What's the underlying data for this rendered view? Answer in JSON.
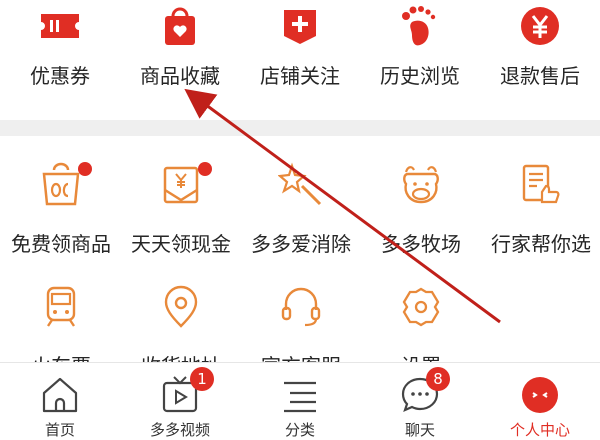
{
  "top_row": [
    {
      "label": "优惠券",
      "icon": "ticket-icon"
    },
    {
      "label": "商品收藏",
      "icon": "shopping-bag-heart-icon"
    },
    {
      "label": "店铺关注",
      "icon": "store-plus-icon"
    },
    {
      "label": "历史浏览",
      "icon": "footprint-icon"
    },
    {
      "label": "退款售后",
      "icon": "yen-coin-icon"
    }
  ],
  "grid_items": [
    {
      "label": "免费领商品",
      "icon": "free-box-icon",
      "has_dot": true
    },
    {
      "label": "天天领现金",
      "icon": "cash-envelope-icon",
      "has_dot": true
    },
    {
      "label": "多多爱消除",
      "icon": "star-wand-icon",
      "has_dot": false
    },
    {
      "label": "多多牧场",
      "icon": "cow-icon",
      "has_dot": false
    },
    {
      "label": "行家帮你选",
      "icon": "thumbs-up-doc-icon",
      "has_dot": false
    },
    {
      "label": "火车票",
      "icon": "train-icon",
      "has_dot": false
    },
    {
      "label": "收货地址",
      "icon": "location-pin-icon",
      "has_dot": false
    },
    {
      "label": "官方客服",
      "icon": "headset-icon",
      "has_dot": false
    },
    {
      "label": "设置",
      "icon": "gear-icon",
      "has_dot": false
    }
  ],
  "tabbar": [
    {
      "label": "首页",
      "icon": "home-icon",
      "badge": "",
      "active": false
    },
    {
      "label": "多多视频",
      "icon": "video-play-icon",
      "badge": "1",
      "active": false
    },
    {
      "label": "分类",
      "icon": "list-icon",
      "badge": "",
      "active": false
    },
    {
      "label": "聊天",
      "icon": "chat-bubble-icon",
      "badge": "8",
      "active": false
    },
    {
      "label": "个人中心",
      "icon": "profile-face-icon",
      "badge": "",
      "active": true
    }
  ],
  "colors": {
    "brand_red": "#e02e24",
    "icon_orange": "#e8893a",
    "annotation_arrow": "#c0201a",
    "band_gray": "#efefef"
  }
}
